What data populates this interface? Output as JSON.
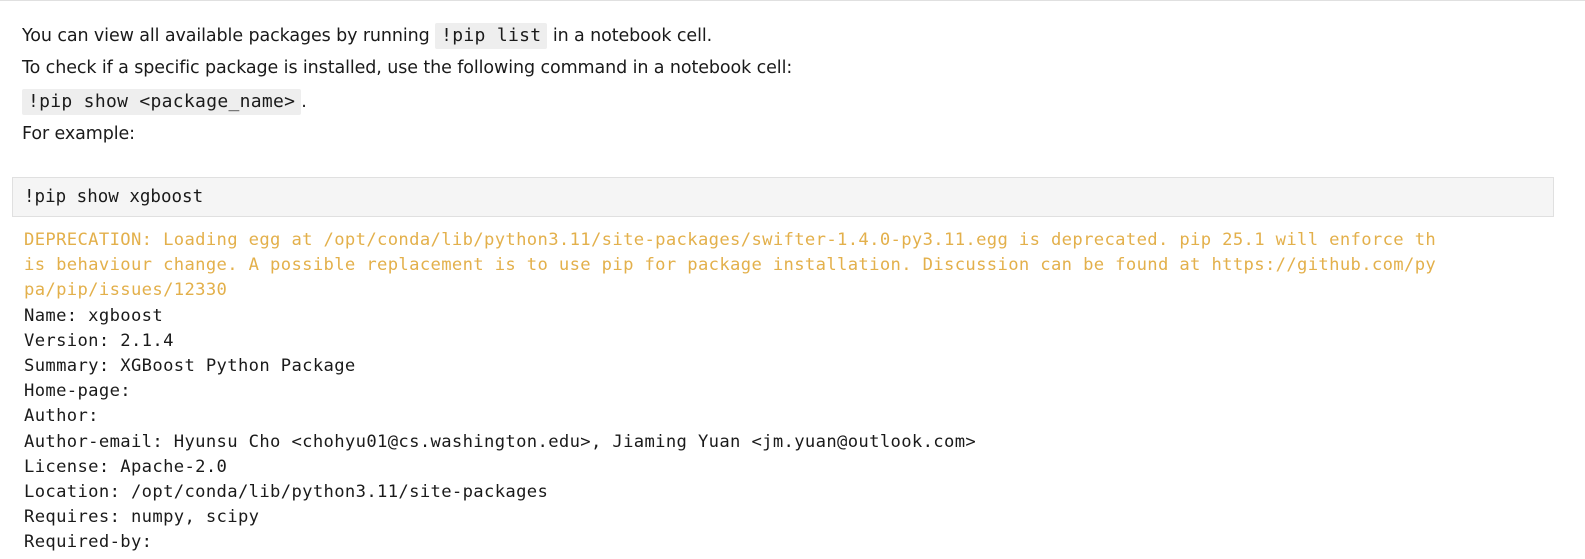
{
  "markdown": {
    "line1_before": "You can view all available packages by running ",
    "line1_code": "!pip list",
    "line1_after": " in a notebook cell.",
    "line2": "To check if a specific package is installed, use the following command in a notebook cell:",
    "line3_code": "!pip show <package_name>",
    "line3_after": ".",
    "line4": "For example:"
  },
  "code_cell": {
    "source": "!pip show xgboost"
  },
  "output": {
    "warning_lines": [
      "DEPRECATION: Loading egg at /opt/conda/lib/python3.11/site-packages/swifter-1.4.0-py3.11.egg is deprecated. pip 25.1 will enforce th",
      "is behaviour change. A possible replacement is to use pip for package installation. Discussion can be found at https://github.com/py",
      "pa/pip/issues/12330"
    ],
    "lines": [
      "Name: xgboost",
      "Version: 2.1.4",
      "Summary: XGBoost Python Package",
      "Home-page: ",
      "Author: ",
      "Author-email: Hyunsu Cho <chohyu01@cs.washington.edu>, Jiaming Yuan <jm.yuan@outlook.com>",
      "License: Apache-2.0",
      "Location: /opt/conda/lib/python3.11/site-packages",
      "Requires: numpy, scipy",
      "Required-by: "
    ]
  },
  "colors": {
    "warning_text": "#e3b04b",
    "code_block_bg": "#f5f5f5",
    "inline_code_bg": "#eeeeee"
  }
}
